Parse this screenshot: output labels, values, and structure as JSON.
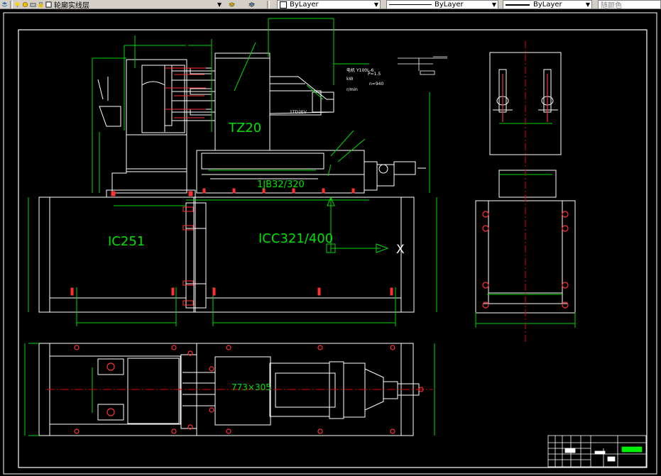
{
  "toolbar": {
    "layer_name": "轮廓实线层",
    "color_combo": "ByLayer",
    "linetype_combo": "ByLayer",
    "lineweight_combo": "ByLayer",
    "plotstyle": "随颜色"
  },
  "drawing": {
    "spindle_box": "TZ20",
    "slide_unit": "1JB32/320",
    "side_base": "IC251",
    "middle_base": "ICC321/400",
    "axis_x": "X",
    "motor_model": "Y100L-6",
    "motor_kw": "kW",
    "motor_power": "P=1.5",
    "motor_speed_unit": "r/min",
    "motor_speed": "n=940",
    "motor_label": "电机",
    "plan_size": "773×305",
    "head_label": "1TD2EV"
  },
  "colors": {
    "background": "#000000",
    "geometry": "#ffffff",
    "dimension": "#00ff00",
    "centerline": "#ff0000",
    "hole": "#ff3333",
    "title_highlight": "#00ff00"
  }
}
